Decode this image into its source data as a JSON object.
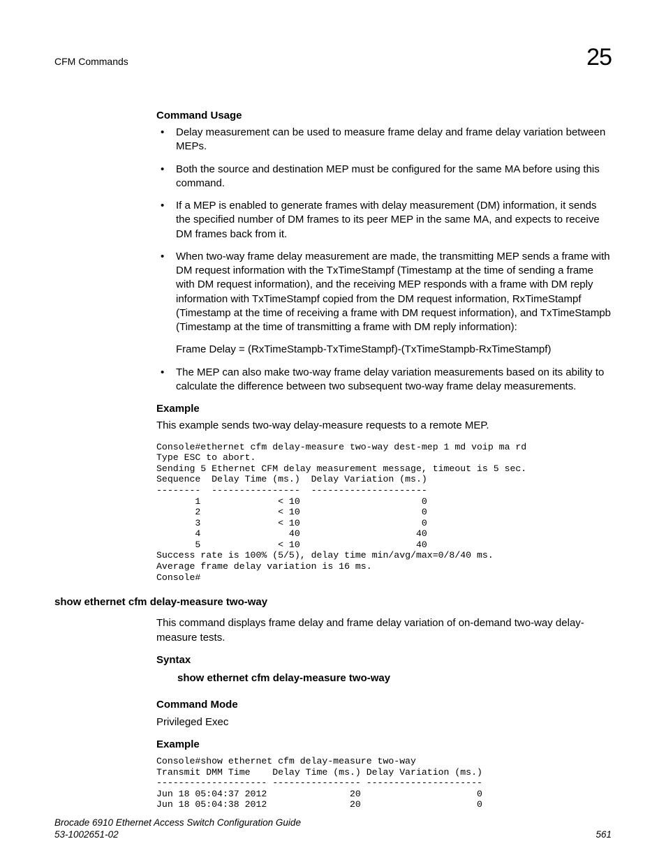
{
  "header": {
    "section": "CFM Commands",
    "chapter": "25"
  },
  "usage": {
    "title": "Command Usage",
    "items": [
      "Delay measurement can be used to measure frame delay and frame delay variation between MEPs.",
      "Both the source and destination MEP must be configured for the same MA before using this command.",
      "If a MEP is enabled to generate frames with delay measurement (DM) information, it sends the specified number of DM frames to its peer MEP in the same MA, and expects to receive DM frames back from it."
    ],
    "item4_main": "When two-way frame delay measurement are made, the transmitting MEP sends a frame with DM request information with the TxTimeStampf (Timestamp at the time of sending a frame with DM request information), and the receiving MEP responds with a frame with DM reply information with TxTimeStampf copied from the DM request information, RxTimeStampf (Timestamp at the time of receiving a frame with DM request information), and TxTimeStampb (Timestamp at the time of transmitting a frame with DM reply information):",
    "item4_sub": "Frame Delay = (RxTimeStampb-TxTimeStampf)-(TxTimeStampb-RxTimeStampf)",
    "item5": "The MEP can also make two-way frame delay variation measurements based on its ability to calculate the difference between two subsequent two-way frame delay measurements."
  },
  "example1": {
    "title": "Example",
    "intro": "This example sends two-way delay-measure requests to a remote MEP.",
    "code": "Console#ethernet cfm delay-measure two-way dest-mep 1 md voip ma rd\nType ESC to abort.\nSending 5 Ethernet CFM delay measurement message, timeout is 5 sec.\nSequence  Delay Time (ms.)  Delay Variation (ms.)\n--------  ----------------  ---------------------\n       1              < 10                      0\n       2              < 10                      0\n       3              < 10                      0\n       4                40                     40\n       5              < 10                     40\nSuccess rate is 100% (5/5), delay time min/avg/max=0/8/40 ms.\nAverage frame delay variation is 16 ms.\nConsole#"
  },
  "cmd2": {
    "name": "show ethernet cfm delay-measure two-way",
    "desc": "This command displays frame delay and frame delay variation of on-demand two-way delay-measure tests.",
    "syntax_title": "Syntax",
    "syntax_line": "show ethernet cfm delay-measure two-way",
    "mode_title": "Command Mode",
    "mode_value": "Privileged Exec",
    "example_title": "Example",
    "example_code": "Console#show ethernet cfm delay-measure two-way\nTransmit DMM Time    Delay Time (ms.) Delay Variation (ms.)\n-------------------- ---------------- ---------------------\nJun 18 05:04:37 2012               20                     0\nJun 18 05:04:38 2012               20                     0"
  },
  "footer": {
    "title": "Brocade 6910 Ethernet Access Switch Configuration Guide",
    "doc": "53-1002651-02",
    "page": "561"
  }
}
